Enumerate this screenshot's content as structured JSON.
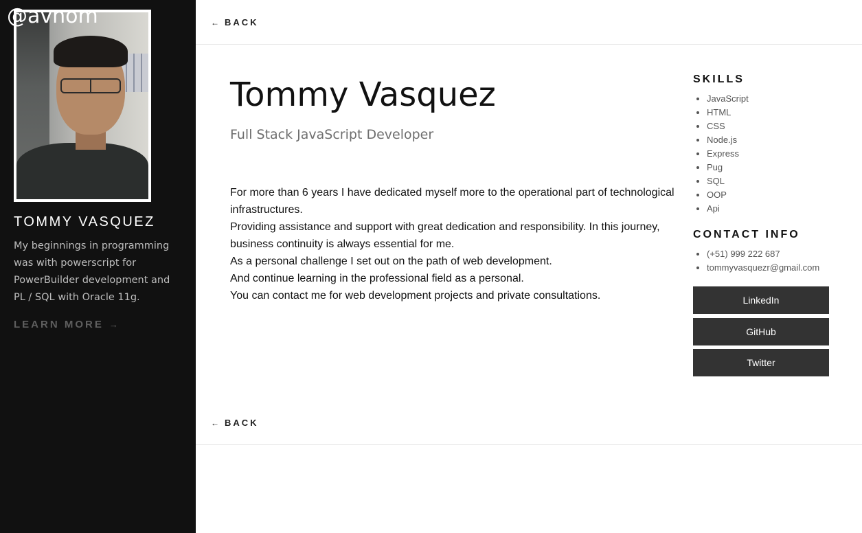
{
  "sidebar": {
    "handle": "@avnom",
    "name": "TOMMY VASQUEZ",
    "bio": "My beginnings in programming was with powerscript for PowerBuilder development and PL / SQL with Oracle 11g.",
    "learn_more": "LEARN MORE",
    "learn_more_arrow": "→"
  },
  "nav": {
    "back_label": "BACK",
    "back_arrow": "←"
  },
  "profile": {
    "name": "Tommy Vasquez",
    "role": "Full Stack JavaScript Developer",
    "about": [
      "For more than 6 years I have dedicated myself more to the operational part of technological infrastructures.",
      "Providing assistance and support with great dedication and responsibility. In this journey, business continuity is always essential for me.",
      "As a personal challenge I set out on the path of web development.",
      "And continue learning in the professional field as a personal.",
      "You can contact me for web development projects and private consultations."
    ]
  },
  "skills": {
    "heading": "SKILLS",
    "items": [
      "JavaScript",
      "HTML",
      "CSS",
      "Node.js",
      "Express",
      "Pug",
      "SQL",
      "OOP",
      "Api"
    ]
  },
  "contact": {
    "heading": "CONTACT INFO",
    "phone": "(+51) 999 222 687",
    "email": "tommyvasquezr@gmail.com"
  },
  "social": {
    "linkedin": "LinkedIn",
    "github": "GitHub",
    "twitter": "Twitter"
  },
  "colors": {
    "sidebar_bg": "#111111",
    "button_bg": "#333333",
    "muted_text": "#6e6e6e"
  }
}
